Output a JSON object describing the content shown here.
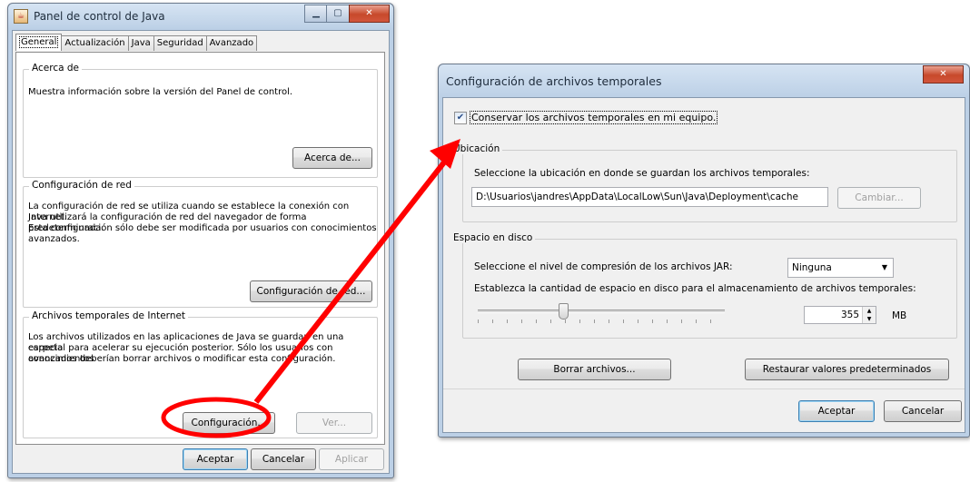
{
  "left_window": {
    "title": "Panel de control de Java",
    "tabs": [
      "General",
      "Actualización",
      "Java",
      "Seguridad",
      "Avanzado"
    ],
    "about": {
      "label": "Acerca de",
      "text": "Muestra información sobre la versión del Panel de control.",
      "button": "Acerca de..."
    },
    "network": {
      "label": "Configuración de red",
      "text1": "La configuración de red se utiliza cuando se establece la conexión con Internet.",
      "text2": "Java utilizará la configuración de red del navegador de forma predeterminada.",
      "text3": "Esta configuración sólo debe ser modificada por usuarios con conocimientos",
      "text4": "avanzados.",
      "button": "Configuración de red..."
    },
    "temp": {
      "label": "Archivos temporales de Internet",
      "text1": "Los archivos utilizados en las aplicaciones de Java se guardan en una carpeta",
      "text2": "especial para acelerar su ejecución posterior. Sólo los usuarios con conocimientos",
      "text3": "avanzados deberían borrar archivos o modificar esta configuración.",
      "settings_button": "Configuración...",
      "view_button": "Ver..."
    },
    "ok": "Aceptar",
    "cancel": "Cancelar",
    "apply": "Aplicar"
  },
  "right_window": {
    "title": "Configuración de archivos temporales",
    "keep_checkbox": {
      "label": "Conservar los archivos temporales en mi equipo.",
      "checked": true
    },
    "location": {
      "label": "Ubicación",
      "text": "Seleccione la ubicación en donde se guardan los archivos temporales:",
      "path": "D:\\Usuarios\\jandres\\AppData\\LocalLow\\Sun\\Java\\Deployment\\cache",
      "change_button": "Cambiar..."
    },
    "disk": {
      "label": "Espacio en disco",
      "compression_text": "Seleccione el nivel de compresión de los archivos JAR:",
      "compression_value": "Ninguna",
      "space_text": "Establezca la cantidad de espacio en disco para el almacenamiento de archivos temporales:",
      "space_value": "355",
      "unit": "MB",
      "slider_fraction": 0.34
    },
    "delete_button": "Borrar archivos...",
    "restore_button": "Restaurar valores predeterminados",
    "ok": "Aceptar",
    "cancel": "Cancelar"
  },
  "colors": {
    "annotation": "#ff0000",
    "accent": "#3c7fb1"
  }
}
